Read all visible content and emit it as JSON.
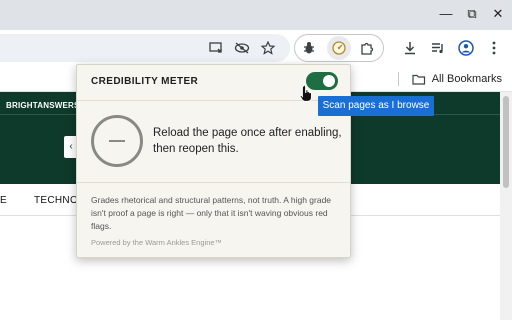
{
  "browser": {
    "window_controls": {
      "minimize": "—",
      "maximize": "⧉",
      "close": "✕"
    },
    "toolbar_icons": [
      "cast-icon",
      "eye-slash-icon",
      "star-icon",
      "bug-extension-icon",
      "meter-extension-icon",
      "puzzle-icon",
      "download-icon",
      "media-icon",
      "profile-icon",
      "menu-icon"
    ],
    "bookmarks": {
      "all_bookmarks_label": "All Bookmarks"
    }
  },
  "page": {
    "site_name": "BRIGHTANSWERS.A",
    "nav_links": [
      "E",
      "TECHNO"
    ]
  },
  "popup": {
    "title": "CREDIBILITY METER",
    "toggle_on": true,
    "message": "Reload the page once after enabling, then reopen this.",
    "disclaimer": "Grades rhetorical and structural patterns, not truth. A high grade isn't proof a page is right — only that it isn't waving obvious red flags.",
    "powered_by": "Powered by the Warm Ankles Engine™"
  },
  "tooltip": {
    "text": "Scan pages as I browse"
  },
  "colors": {
    "accent": "#1f6e43",
    "header_bg": "#0e3a2b",
    "tooltip_bg": "#1a6fd4",
    "popup_bg": "#f7f5ef"
  }
}
